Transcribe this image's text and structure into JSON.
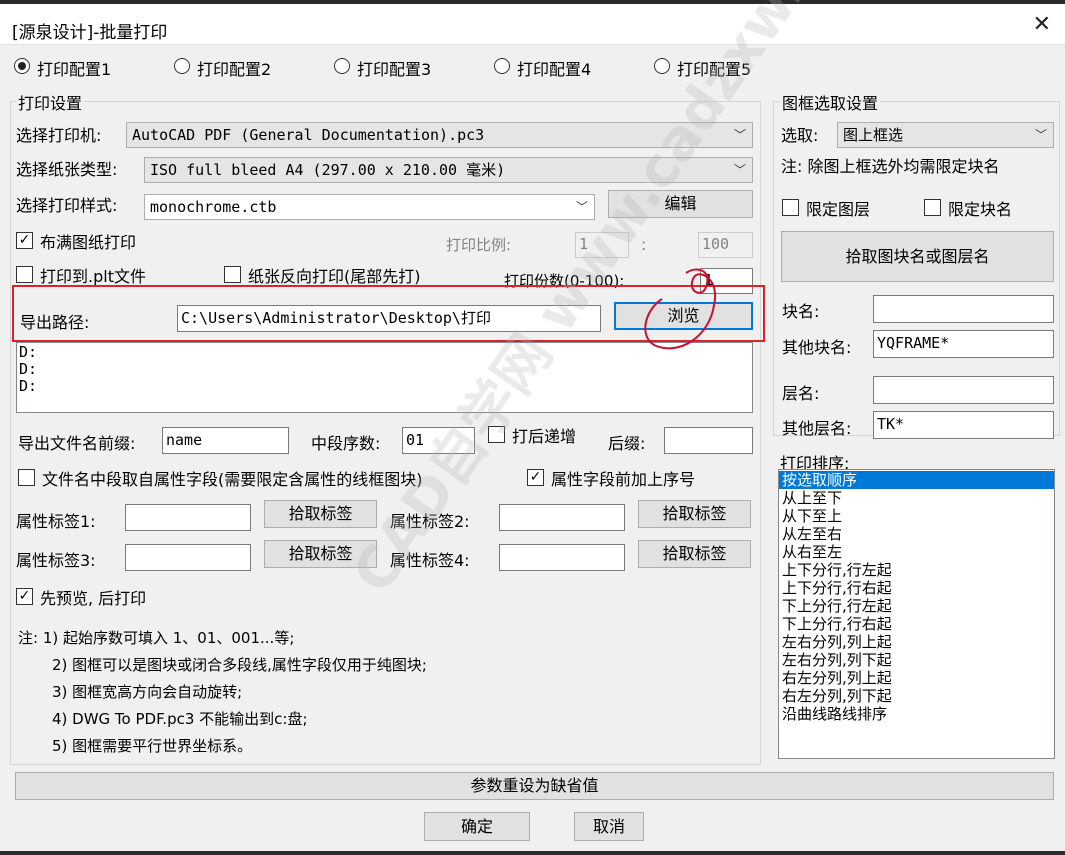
{
  "window": {
    "title": "[源泉设计]-批量打印"
  },
  "profiles": [
    "打印配置1",
    "打印配置2",
    "打印配置3",
    "打印配置4",
    "打印配置5"
  ],
  "print_settings": {
    "group_title": "打印设置",
    "printer_label": "选择打印机:",
    "printer_value": "AutoCAD PDF (General Documentation).pc3",
    "paper_label": "选择纸张类型:",
    "paper_value": "ISO full bleed A4 (297.00 x 210.00 毫米)",
    "style_label": "选择打印样式:",
    "style_value": "monochrome.ctb",
    "edit_button": "编辑",
    "fit_paper": "布满图纸打印",
    "scale_label": "打印比例:",
    "scale_left": "1",
    "scale_sep": ":",
    "scale_right": "100",
    "to_plt": "打印到.plt文件",
    "reverse": "纸张反向打印(尾部先打)",
    "copies_label": "打印份数(0-100):",
    "copies_value": "1",
    "export_path_label": "导出路径:",
    "export_path_value": "C:\\Users\\Administrator\\Desktop\\打印",
    "browse_button": "浏览",
    "drive_lines": [
      "D:",
      "D:",
      "D:"
    ],
    "prefix_label": "导出文件名前缀:",
    "prefix_value": "name",
    "mid_seq_label": "中段序数:",
    "mid_seq_value": "01",
    "increment_after_print": "打后递增",
    "suffix_label": "后缀:",
    "suffix_value": "",
    "attr_mid_field": "文件名中段取自属性字段(需要限定含属性的线框图块)",
    "attr_prefix_seq": "属性字段前加上序号",
    "attr_tag1_label": "属性标签1:",
    "attr_tag2_label": "属性标签2:",
    "attr_tag3_label": "属性标签3:",
    "attr_tag4_label": "属性标签4:",
    "pick_tag_button": "拾取标签",
    "preview_first": "先预览, 后打印",
    "notes": [
      "注: 1) 起始序数可填入 1、01、001...等;",
      "2) 图框可以是图块或闭合多段线,属性字段仅用于纯图块;",
      "3) 图框宽高方向会自动旋转;",
      "4) DWG To PDF.pc3 不能输出到c:盘;",
      "5) 图框需要平行世界坐标系。"
    ]
  },
  "frame_settings": {
    "group_title": "图框选取设置",
    "select_label": "选取:",
    "select_value": "图上框选",
    "hint": "注: 除图上框选外均需限定块名",
    "limit_layer": "限定图层",
    "limit_block": "限定块名",
    "pick_button": "拾取图块名或图层名",
    "block_name_label": "块名:",
    "block_name_value": "",
    "other_block_label": "其他块名:",
    "other_block_value": "YQFRAME*",
    "layer_name_label": "层名:",
    "layer_name_value": "",
    "other_layer_label": "其他层名:",
    "other_layer_value": "TK*"
  },
  "print_order": {
    "label": "打印排序:",
    "items": [
      "按选取顺序",
      "从上至下",
      "从下至上",
      "从左至右",
      "从右至左",
      "上下分行,行左起",
      "上下分行,行右起",
      "下上分行,行左起",
      "下上分行,行右起",
      "左右分列,列上起",
      "左右分列,列下起",
      "右左分列,列上起",
      "右左分列,列下起",
      "沿曲线路线排序"
    ],
    "selected_index": 0
  },
  "footer": {
    "reset_button": "参数重设为缺省值",
    "ok_button": "确定",
    "cancel_button": "取消"
  },
  "watermark": "CAD自学网 www.cadzxw.com"
}
